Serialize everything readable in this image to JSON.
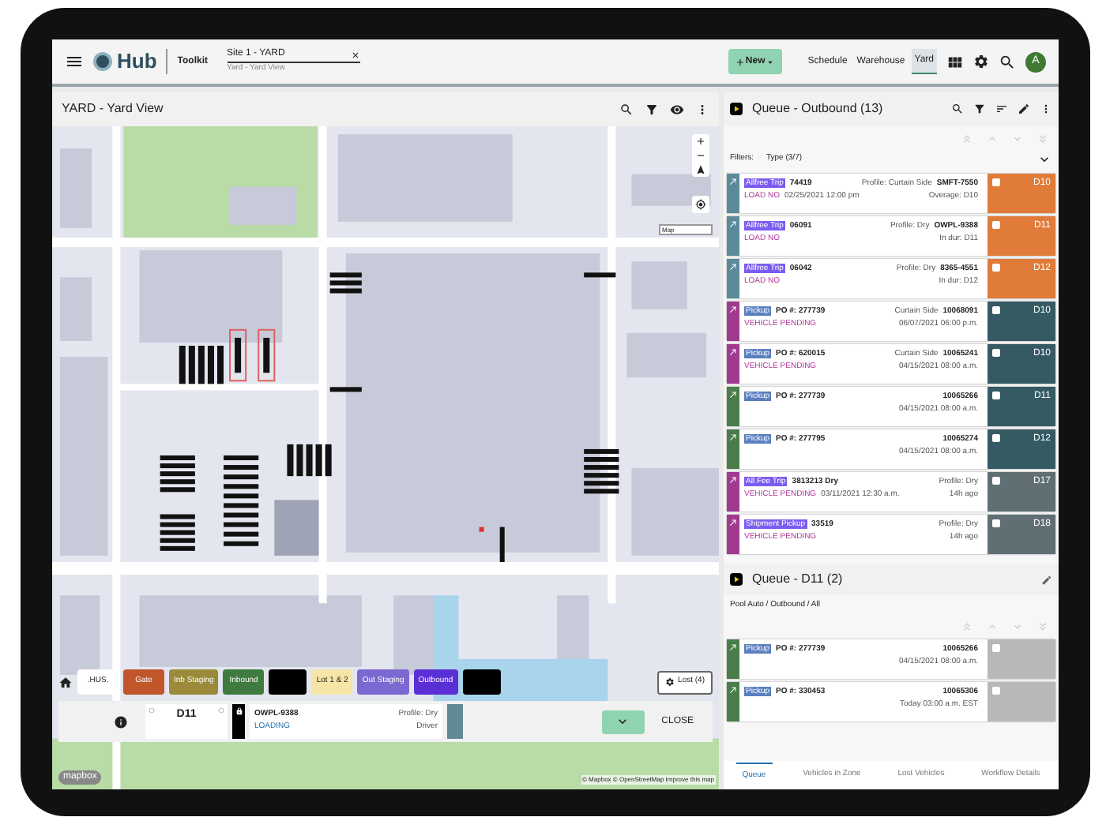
{
  "header": {
    "logo": "Hub",
    "toolkit": "Toolkit",
    "site_field": {
      "value": "Site 1 - YARD",
      "helper": "Yard - Yard View"
    },
    "new_button": "New",
    "nav": [
      {
        "label": "Schedule",
        "selected": false
      },
      {
        "label": "Warehouse",
        "selected": false
      },
      {
        "label": "Yard",
        "selected": true
      }
    ],
    "avatar": "A"
  },
  "yard_panel": {
    "title": "YARD - Yard View",
    "map_style_label": "Map",
    "zones": [
      {
        "label": ".HUS.",
        "color": "#ffffff"
      },
      {
        "label": "Gate",
        "color": "#c0562a"
      },
      {
        "label": "Inb Staging",
        "color": "#9a8a3a"
      },
      {
        "label": "Inbound",
        "color": "#3f7a3f"
      },
      {
        "color": "#000000"
      },
      {
        "label": "Lot 1 & 2",
        "color": "#f5e6a6"
      },
      {
        "label": "Out Staging",
        "color": "#7b68d0"
      },
      {
        "label": "Outbound",
        "color": "#5b2fd6"
      },
      {
        "color": "#000000"
      }
    ],
    "lost_button": "Lost (4)",
    "detail": {
      "door": "D11",
      "trailer": "OWPL-9388",
      "status": "LOADING",
      "profile": "Profile: Dry",
      "driver": "Driver",
      "close": "CLOSE"
    },
    "attribution": "© Mapbox © OpenStreetMap Improve this map",
    "map_logo": "mapbox"
  },
  "outbound_queue": {
    "title": "Queue - Outbound (13)",
    "filters_label": "Filters:",
    "filter_value": "Type (3/7)",
    "cards": [
      {
        "kind": "trip",
        "badge": "Allfree Trip",
        "number": "74419",
        "status": "LOAD NO",
        "date": "02/25/2021 12:00 pm",
        "profile": "Profile: Curtain Side",
        "trailer": "SMFT-7550",
        "sub": "Overage: D10",
        "door": {
          "label": "D10",
          "color": "#e07b39"
        },
        "color": "#5b8a9a",
        "checked": false
      },
      {
        "kind": "trip",
        "badge": "Allfree Trip",
        "number": "06091",
        "status": "LOAD NO",
        "profile": "Profile: Dry",
        "trailer": "OWPL-9388",
        "sub": "In dur: D11",
        "door": {
          "label": "D11",
          "color": "#e07b39"
        },
        "color": "#5b8a9a",
        "checked": false
      },
      {
        "kind": "trip",
        "badge": "Allfree Trip",
        "number": "06042",
        "status": "LOAD NO",
        "profile": "Profile: Dry",
        "trailer": "8365-4551",
        "sub": "In dur: D12",
        "door": {
          "label": "D12",
          "color": "#e07b39"
        },
        "color": "#5b8a9a",
        "checked": false
      },
      {
        "kind": "pickup",
        "badge": "Pickup",
        "number": "PO #: 277739",
        "status": "VEHICLE PENDING",
        "profile": "Curtain Side",
        "trailer": "10068091",
        "sub": "06/07/2021 06:00 p.m.",
        "door": {
          "label": "D10",
          "color": "#355a63"
        },
        "color": "#a03a8f",
        "checked": false
      },
      {
        "kind": "pickup",
        "badge": "Pickup",
        "number": "PO #: 620015",
        "status": "VEHICLE PENDING",
        "profile": "Curtain Side",
        "trailer": "10065241",
        "sub": "04/15/2021 08:00 a.m.",
        "door": {
          "label": "D10",
          "color": "#355a63"
        },
        "color": "#a03a8f",
        "checked": false
      },
      {
        "kind": "pickup",
        "badge": "Pickup",
        "number": "PO #: 277739",
        "trailer": "10065266",
        "sub": "04/15/2021 08:00 a.m.",
        "door": {
          "label": "D11",
          "color": "#355a63"
        },
        "color": "#4a7d4a",
        "checked": false
      },
      {
        "kind": "pickup",
        "badge": "Pickup",
        "number": "PO #: 277795",
        "trailer": "10065274",
        "sub": "04/15/2021 08:00 a.m.",
        "door": {
          "label": "D12",
          "color": "#355a63"
        },
        "color": "#4a7d4a",
        "checked": false
      },
      {
        "kind": "trip",
        "badge": "All Fee Trip",
        "number": "3813213 Dry",
        "status": "VEHICLE PENDING",
        "date": "03/11/2021 12:30 a.m.",
        "profile": "Profile: Dry",
        "sub": "14h ago",
        "door": {
          "label": "D17",
          "color": "#5f6f74"
        },
        "color": "#a03a8f",
        "checked": false
      },
      {
        "kind": "trip",
        "badge": "Shipment Pickup",
        "number": "33519",
        "status": "VEHICLE PENDING",
        "profile": "Profile: Dry",
        "sub": "14h ago",
        "door": {
          "label": "D18",
          "color": "#5f6f74"
        },
        "color": "#a03a8f",
        "checked": false
      }
    ]
  },
  "door_queue": {
    "title": "Queue - D11 (2)",
    "path": "Pool Auto / Outbound / All",
    "cards": [
      {
        "kind": "pickup",
        "badge": "Pickup",
        "number": "PO #: 277739",
        "trailer": "10065266",
        "sub": "04/15/2021 08:00 a.m.",
        "door": {
          "color": "#b8b8b8"
        },
        "color": "#4a7d4a",
        "checked": false
      },
      {
        "kind": "pickup",
        "badge": "Pickup",
        "number": "PO #: 330453",
        "trailer": "10065306",
        "sub": "Today 03:00 a.m. EST",
        "door": {
          "color": "#b8b8b8"
        },
        "color": "#4a7d4a",
        "checked": false
      }
    ]
  },
  "bottom_tabs": [
    {
      "label": "Queue",
      "selected": true
    },
    {
      "label": "Vehicles in Zone",
      "selected": false
    },
    {
      "label": "Lost Vehicles",
      "selected": false
    },
    {
      "label": "Workflow Details",
      "selected": false
    }
  ]
}
